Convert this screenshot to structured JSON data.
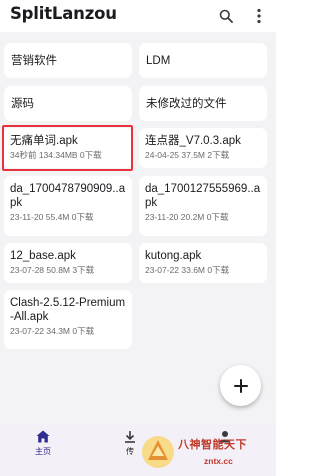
{
  "app": {
    "title": "SplitLanzou",
    "search_icon": "search-icon",
    "menu_icon": "more-vert-icon"
  },
  "folders": [
    {
      "name": "营销软件"
    },
    {
      "name": "LDM"
    },
    {
      "name": "源码"
    },
    {
      "name": "未修改过的文件"
    }
  ],
  "files": [
    {
      "name": "无痛单词.apk",
      "meta": "34秒前 134.34MB 0下载"
    },
    {
      "name": "连点器_V7.0.3.apk",
      "meta": "24-04-25 37.5M 2下载"
    },
    {
      "name": "da_1700478790909..apk",
      "meta": "23-11-20 55.4M 0下载"
    },
    {
      "name": "da_1700127555969..apk",
      "meta": "23-11-20 20.2M 0下载"
    },
    {
      "name": "12_base.apk",
      "meta": "23-07-28 50.8M 3下载"
    },
    {
      "name": "kutong.apk",
      "meta": "23-07-22 33.6M 0下载"
    },
    {
      "name": "Clash-2.5.12-Premium-All.apk",
      "meta": "23-07-22 34.3M 0下载"
    }
  ],
  "fab": {
    "icon": "plus-icon"
  },
  "nav": [
    {
      "label": "主页",
      "icon": "home-icon",
      "active": true
    },
    {
      "label": "传",
      "icon": "transfer-icon",
      "active": false
    },
    {
      "label": "",
      "icon": "person-icon",
      "active": false
    }
  ],
  "watermark": {
    "line1": "八神智能天下",
    "line2": "zntx.cc"
  },
  "colors": {
    "accent": "#2f2c8f",
    "highlight_border": "#e8323c",
    "background": "#f3f3f5",
    "card": "#ffffff"
  }
}
